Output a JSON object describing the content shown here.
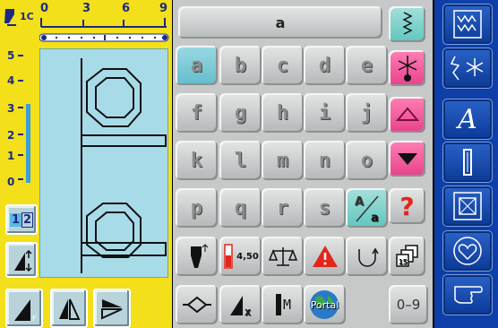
{
  "ruler": {
    "label": "1C",
    "marks": [
      "0",
      "3",
      "6",
      "9"
    ]
  },
  "side_scale": [
    "5",
    "4",
    "3",
    "2",
    "1",
    "0"
  ],
  "left_buttons": {
    "page_label": "2",
    "page_active": "1"
  },
  "display": {
    "text": "a"
  },
  "keys": [
    [
      "a",
      "b",
      "c",
      "d",
      "e"
    ],
    [
      "f",
      "g",
      "h",
      "i",
      "j"
    ],
    [
      "k",
      "l",
      "m",
      "n",
      "o"
    ],
    [
      "p",
      "q",
      "r",
      "s"
    ]
  ],
  "bottom_row": {
    "size_label": "4,50",
    "m_label": "M",
    "portal_label": "Portal",
    "digits_label": "0–9"
  },
  "colors": {
    "panel_yellow": "#f3df1a",
    "keyboard_grey": "#c7c9c9",
    "sidebar_blue": "#0e3fa8",
    "selected_cyan": "#63bdcc",
    "accent_pink": "#e8428a"
  }
}
